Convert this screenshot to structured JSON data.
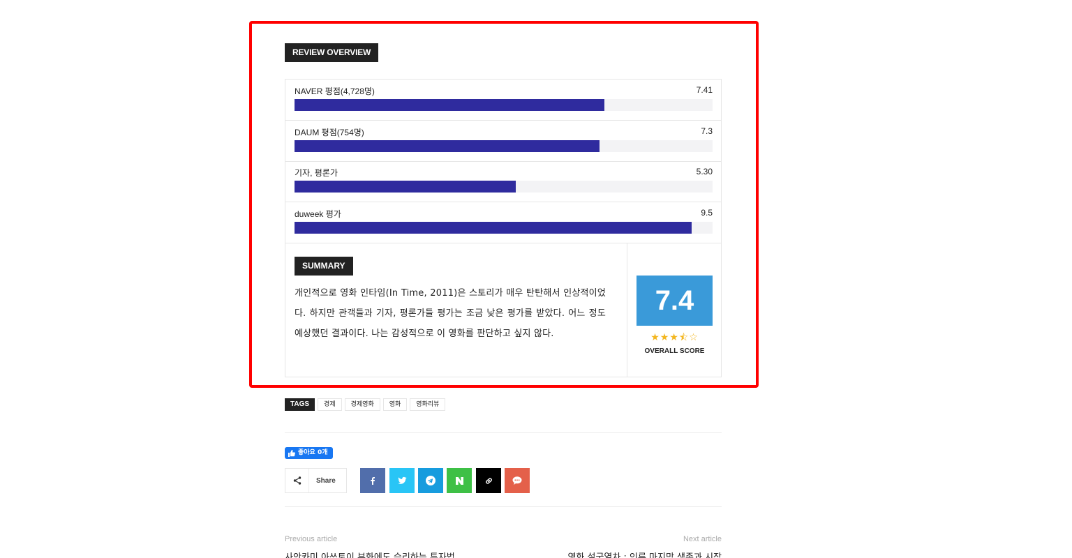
{
  "review": {
    "title": "REVIEW OVERVIEW",
    "rows": [
      {
        "label": "NAVER 평점(4,728명)",
        "value": "7.41",
        "score": 7.41
      },
      {
        "label": "DAUM 평점(754명)",
        "value": "7.3",
        "score": 7.3
      },
      {
        "label": "기자, 평론가",
        "value": "5.30",
        "score": 5.3
      },
      {
        "label": "duweek 평가",
        "value": "9.5",
        "score": 9.5
      }
    ],
    "summary_title": "SUMMARY",
    "summary_text": "개인적으로 영화 인타임(In Time, 2011)은 스토리가 매우 탄탄해서 인상적이었다. 하지만 관객들과 기자, 평론가들 평가는 조금 낮은 평가를 받았다. 어느 정도 예상했던 결과이다. 나는 감성적으로 이 영화를 판단하고 싶지 않다.",
    "overall_score": "7.4",
    "overall_label": "OVERALL SCORE",
    "stars": {
      "value": 3.5,
      "max": 5
    }
  },
  "tags": {
    "label": "TAGS",
    "items": [
      "경제",
      "경제영화",
      "영화",
      "영화리뷰"
    ]
  },
  "social": {
    "like_label": "좋아요 0개",
    "share_label": "Share",
    "buttons": [
      {
        "name": "facebook",
        "color": "#516eab",
        "icon": "facebook-icon"
      },
      {
        "name": "twitter",
        "color": "#29c5f6",
        "icon": "twitter-icon"
      },
      {
        "name": "telegram",
        "color": "#179cde",
        "icon": "telegram-icon"
      },
      {
        "name": "naver",
        "color": "#3ec046",
        "icon": "naver-icon"
      },
      {
        "name": "copy",
        "color": "#000000",
        "icon": "link-icon"
      },
      {
        "name": "kakaostory",
        "color": "#e4604a",
        "icon": "chat-icon"
      }
    ]
  },
  "navigation": {
    "previous_label": "Previous article",
    "previous_title": "사안카미 아쓰토이 부화에도 승리하는 투자법",
    "next_label": "Next article",
    "next_title": "영화 설국열차 : 인류 마지막 생존과 시작"
  }
}
